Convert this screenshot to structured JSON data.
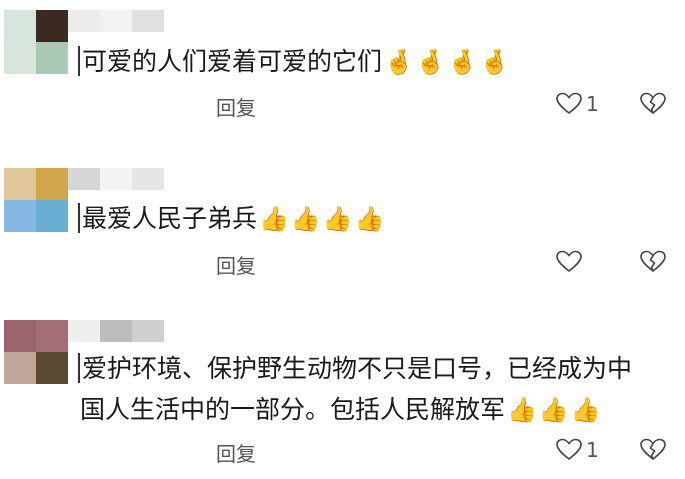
{
  "comments": [
    {
      "avatar_colors": [
        "#d7e6dc",
        "#3b2a20",
        "#d9e4dc",
        "#a9c9b6"
      ],
      "name_colors": [
        "#ececec",
        "#f3f3f3",
        "#e0e0e0"
      ],
      "text": "可爱的人们爱着可爱的它们",
      "line2": "",
      "emoji": "🤞🤞🤞🤞",
      "reply_label": "回复",
      "like_count": "1"
    },
    {
      "avatar_colors": [
        "#dfc79a",
        "#d2a64a",
        "#86b6e3",
        "#6aaed3"
      ],
      "name_colors": [
        "#d6d6d6",
        "#f3f3f3",
        "#e6e6e6"
      ],
      "text": "最爱人民子弟兵",
      "line2": "",
      "emoji": "👍👍👍👍",
      "reply_label": "回复",
      "like_count": ""
    },
    {
      "avatar_colors": [
        "#9b6570",
        "#a46d78",
        "#bfa898",
        "#5b4a33"
      ],
      "name_colors": [
        "#efefef",
        "#bdbdbd",
        "#cfcfcf"
      ],
      "text": "爱护环境、保护野生动物不只是口号，已经成为中",
      "line2": "国人生活中的一部分。包括人民解放军",
      "emoji": "👍👍👍",
      "reply_label": "回复",
      "like_count": "1"
    }
  ]
}
